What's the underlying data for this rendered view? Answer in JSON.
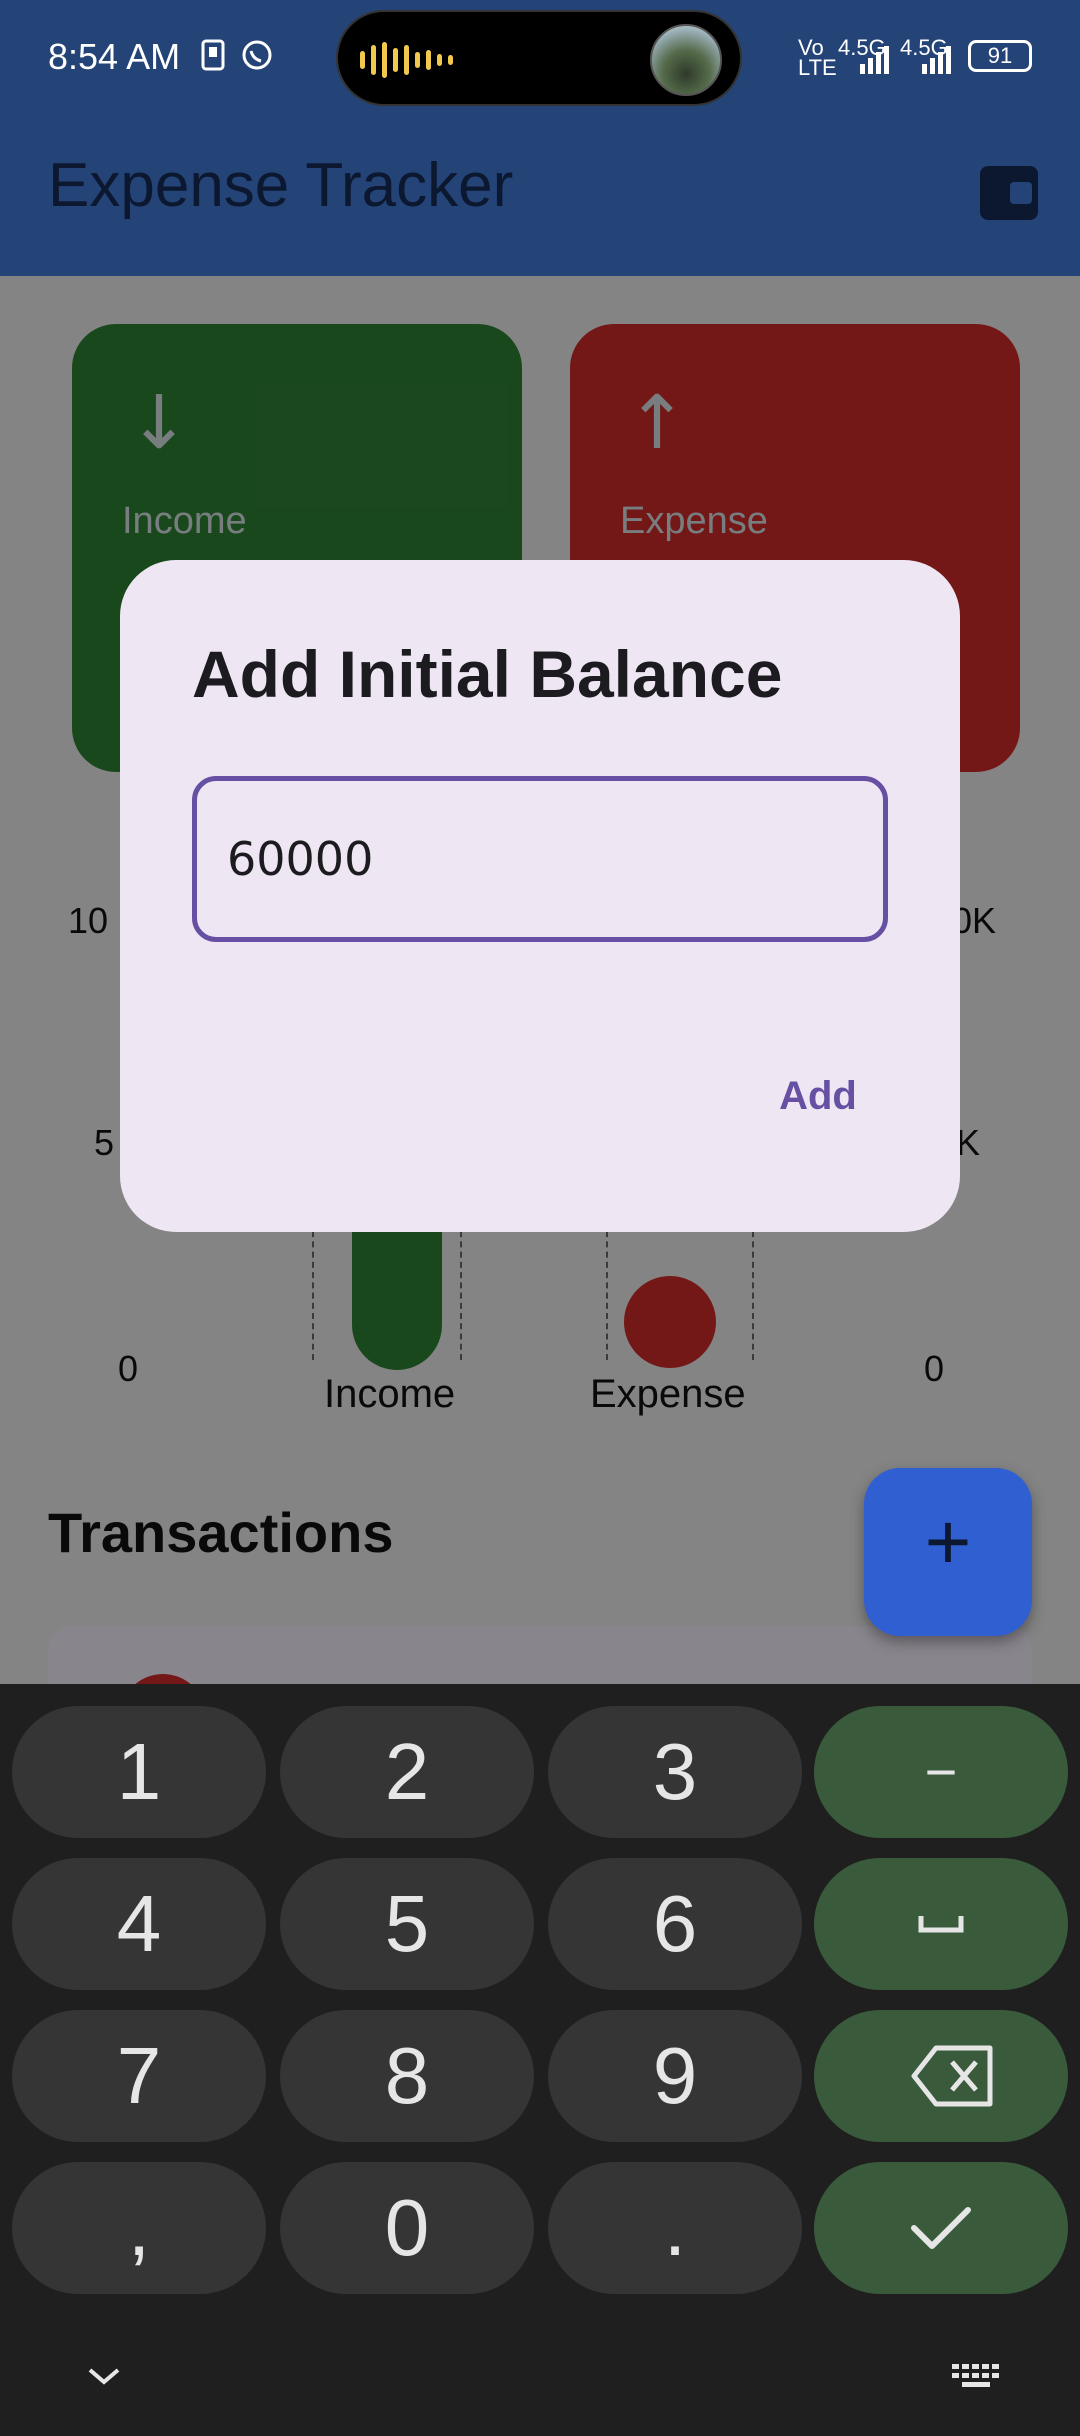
{
  "status_bar": {
    "time": "8:54 AM",
    "network_left": "Vo\nLTE",
    "network_1": "4.5G",
    "network_2": "4.5G",
    "battery": "91"
  },
  "app_bar": {
    "title": "Expense Tracker",
    "action_icon": "wallet-icon"
  },
  "summary_cards": {
    "income_label": "Income",
    "expense_label": "Expense"
  },
  "chart": {
    "left_ticks": [
      "10",
      "5",
      "0"
    ],
    "right_ticks": [
      "0K",
      "K",
      "0"
    ],
    "categories": [
      "Income",
      "Expense"
    ]
  },
  "transactions": {
    "title": "Transactions",
    "fab_label": "+"
  },
  "dialog": {
    "title": "Add Initial Balance",
    "input_value": "60000",
    "add_label": "Add"
  },
  "keyboard": {
    "row1": [
      "1",
      "2",
      "3",
      "−"
    ],
    "row2": [
      "4",
      "5",
      "6"
    ],
    "row3": [
      "7",
      "8",
      "9"
    ],
    "row4": [
      ",",
      "0",
      "."
    ]
  }
}
